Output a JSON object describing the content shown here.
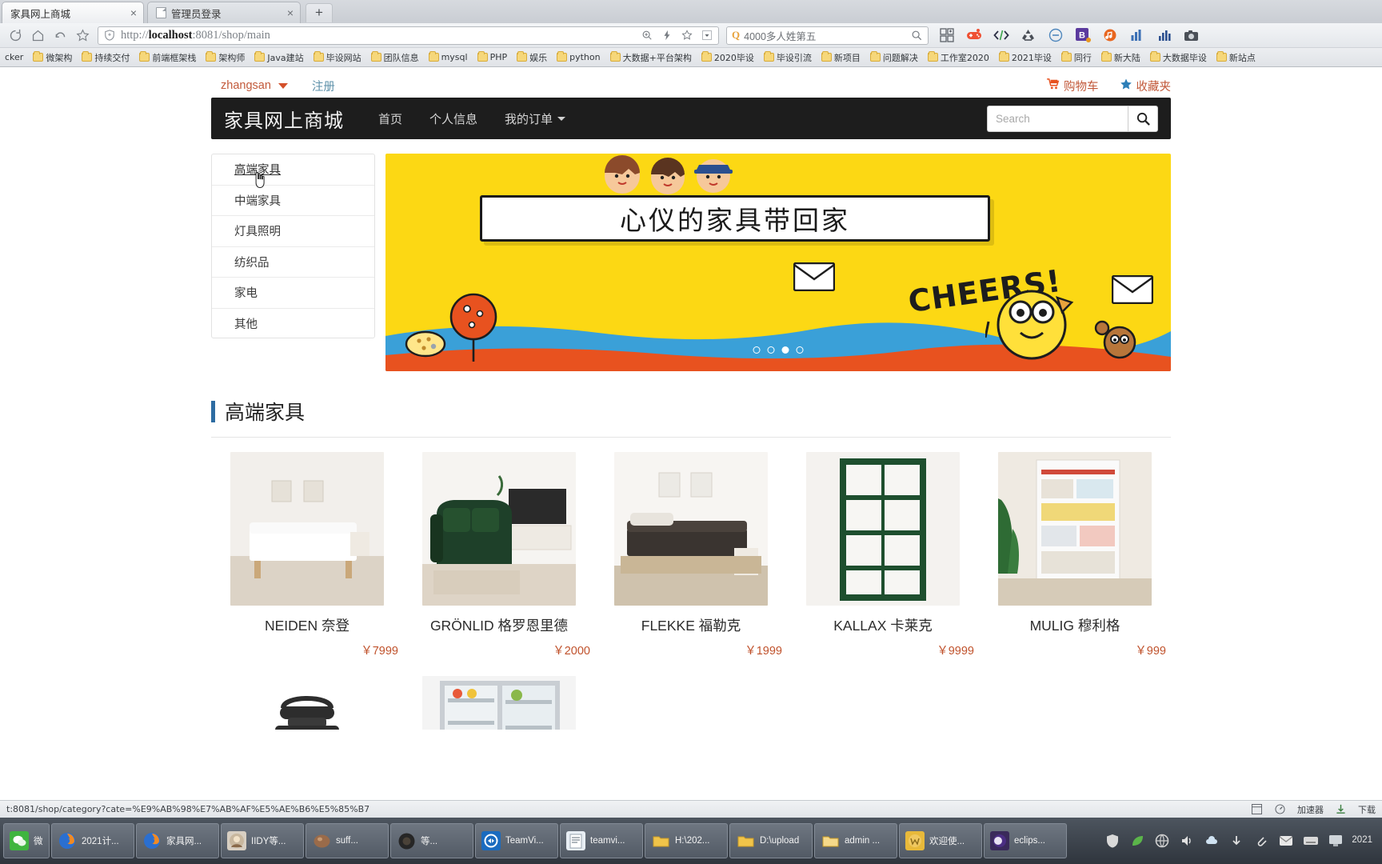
{
  "browser": {
    "tabs": [
      {
        "title": "家具网上商城",
        "active": true,
        "close_label": "×"
      },
      {
        "title": "管理员登录",
        "active": false,
        "close_label": "×"
      }
    ],
    "new_tab_label": "+",
    "url_prefix": "http://",
    "url_host": "localhost",
    "url_rest": ":8081/shop/main",
    "url_full": "http://localhost:8081/shop/main",
    "search_engine_glyph": "Q",
    "search_value": "4000多人姓第五",
    "nav_icons": [
      "refresh-icon",
      "home-icon",
      "back-icon",
      "bookmark-star-icon"
    ],
    "url_toolbar_icons": [
      "zoom-icon",
      "lightning-icon",
      "star-icon",
      "dropdown-icon"
    ],
    "extension_icons": [
      "grid-add-icon",
      "gamepad-icon",
      "code-icon",
      "recycle-icon",
      "block-icon",
      "b-badge-icon",
      "music-icon",
      "chart-icon",
      "bars-icon",
      "camera-icon"
    ],
    "bookmarks": [
      "cker",
      "微架构",
      "持续交付",
      "前端框架栈",
      "架构师",
      "Java建站",
      "毕设网站",
      "团队信息",
      "mysql",
      "PHP",
      "娱乐",
      "python",
      "大数据+平台架构",
      "2020毕设",
      "毕设引流",
      "新项目",
      "问题解决",
      "工作室2020",
      "2021毕设",
      "同行",
      "新大陆",
      "大数据毕设",
      "新站点"
    ]
  },
  "topbar": {
    "username": "zhangsan",
    "register_label": "注册",
    "cart_label": "购物车",
    "favorites_label": "收藏夹"
  },
  "navbar": {
    "brand": "家具网上商城",
    "links": [
      {
        "label": "首页",
        "caret": false
      },
      {
        "label": "个人信息",
        "caret": false
      },
      {
        "label": "我的订单",
        "caret": true
      }
    ],
    "search_placeholder": "Search",
    "search_value": "",
    "search_button_icon": "search-icon"
  },
  "sidebar": {
    "items": [
      {
        "label": "高端家具",
        "active": true
      },
      {
        "label": "中端家具",
        "active": false
      },
      {
        "label": "灯具照明",
        "active": false
      },
      {
        "label": "纺织品",
        "active": false
      },
      {
        "label": "家电",
        "active": false
      },
      {
        "label": "其他",
        "active": false
      }
    ]
  },
  "banner": {
    "headline": "心仪的家具带回家",
    "cheers_text": "CHEERS!",
    "dot_count": 4,
    "active_dot": 3,
    "bg_color": "#fcd814",
    "wave_color": "#3aa0d8",
    "accent_color": "#e8521f"
  },
  "section": {
    "title": "高端家具",
    "accent_color": "#2d6ca2"
  },
  "products": [
    {
      "name": "NEIDEN 奈登",
      "price": "￥7999",
      "image": "bed-white-room"
    },
    {
      "name": "GRÖNLID 格罗恩里德",
      "price": "￥2000",
      "image": "green-sofa-tv"
    },
    {
      "name": "FLEKKE 福勒克",
      "price": "￥1999",
      "image": "daybed-dark"
    },
    {
      "name": "KALLAX 卡莱克",
      "price": "￥9999",
      "image": "green-shelf-unit"
    },
    {
      "name": "MULIG 穆利格",
      "price": "￥999",
      "image": "balcony-shelving"
    },
    {
      "name": "",
      "price": "",
      "image": "lantern-lamp"
    },
    {
      "name": "",
      "price": "",
      "image": "refrigerator-open"
    }
  ],
  "statusbar": {
    "url": "t:8081/shop/category?cate=%E9%AB%98%E7%AB%AF%E5%AE%B6%E5%85%B7",
    "accelerator_label": "加速器",
    "download_label": "下载",
    "icons": [
      "window-icon",
      "gauge-icon",
      "download-icon"
    ]
  },
  "taskbar": {
    "items": [
      {
        "label": "微信",
        "icon": "wechat-icon",
        "narrow": true
      },
      {
        "label": "2021计...",
        "icon": "firefox-icon",
        "narrow": false
      },
      {
        "label": "家具网...",
        "icon": "firefox-icon",
        "narrow": false
      },
      {
        "label": "IIDY等...",
        "icon": "photo-icon",
        "narrow": false
      },
      {
        "label": "suff...",
        "icon": "brown-icon",
        "narrow": false
      },
      {
        "label": "等...",
        "icon": "dark-circle-icon",
        "narrow": false
      },
      {
        "label": "TeamVi...",
        "icon": "teamviewer-icon",
        "narrow": false
      },
      {
        "label": "teamvi...",
        "icon": "doc-icon",
        "narrow": false
      },
      {
        "label": "H:\\202...",
        "icon": "folder-icon",
        "narrow": false
      },
      {
        "label": "D:\\upload",
        "icon": "folder-icon",
        "narrow": false
      },
      {
        "label": "admin ...",
        "icon": "folder-yellow-icon",
        "narrow": false
      },
      {
        "label": "欢迎使...",
        "icon": "word-icon",
        "narrow": false
      },
      {
        "label": "eclips...",
        "icon": "eclipse-icon",
        "narrow": false
      }
    ],
    "tray_icons": [
      "shield-icon",
      "leaf-icon",
      "net-icon",
      "volume-icon",
      "cloud-icon",
      "arrow-icon",
      "clip-icon",
      "mail-icon",
      "keyboard-icon",
      "screen-icon"
    ],
    "clock": "2021"
  }
}
